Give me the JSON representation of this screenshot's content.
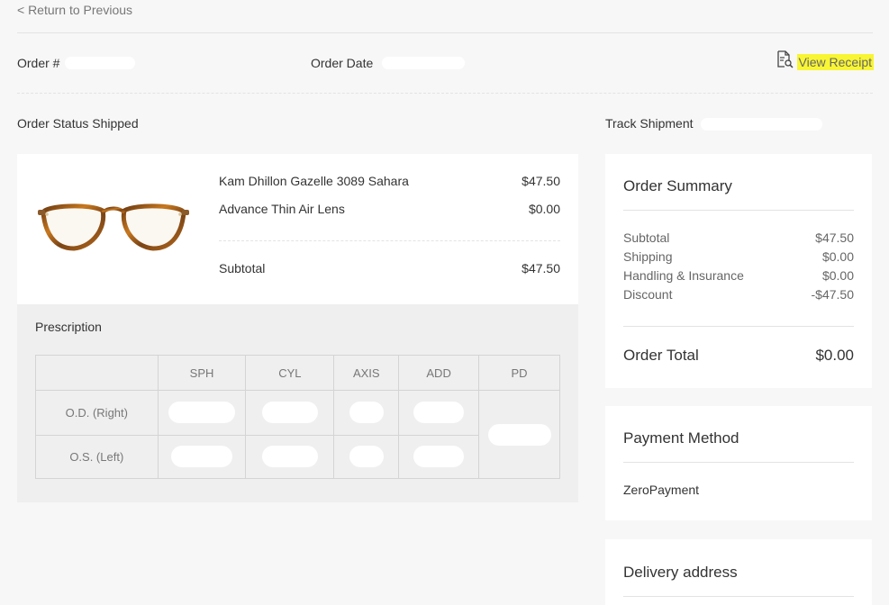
{
  "nav": {
    "back_label": "< Return to Previous"
  },
  "order": {
    "number_label": "Order #",
    "date_label": "Order Date",
    "receipt_label": "View Receipt",
    "status_label": "Order Status Shipped",
    "track_label": "Track Shipment"
  },
  "items": [
    {
      "name": "Kam Dhillon Gazelle 3089 Sahara",
      "price": "$47.50"
    },
    {
      "name": "Advance Thin Air Lens",
      "price": "$0.00"
    }
  ],
  "items_subtotal": {
    "label": "Subtotal",
    "value": "$47.50"
  },
  "prescription": {
    "title": "Prescription",
    "columns": [
      "",
      "SPH",
      "CYL",
      "AXIS",
      "ADD",
      "PD"
    ],
    "rows": [
      "O.D. (Right)",
      "O.S. (Left)"
    ]
  },
  "summary": {
    "title": "Order Summary",
    "rows": [
      {
        "label": "Subtotal",
        "value": "$47.50"
      },
      {
        "label": "Shipping",
        "value": "$0.00"
      },
      {
        "label": "Handling & Insurance",
        "value": "$0.00"
      },
      {
        "label": "Discount",
        "value": "-$47.50"
      }
    ],
    "total_label": "Order Total",
    "total_value": "$0.00"
  },
  "payment": {
    "title": "Payment Method",
    "value": "ZeroPayment"
  },
  "delivery": {
    "title": "Delivery address"
  },
  "colors": {
    "highlight": "#f8f535",
    "background": "#f7f7f7",
    "panel": "#ffffff",
    "prescription_bg": "#efefef"
  },
  "icons": {
    "receipt": "receipt-search-icon",
    "product": "eyeglasses-image"
  }
}
